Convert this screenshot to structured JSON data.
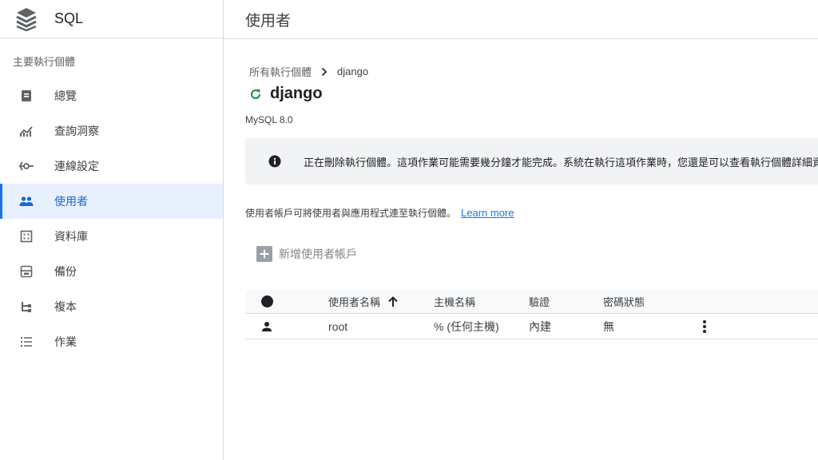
{
  "brand": {
    "title": "SQL",
    "logo_icon": "sql-stack-icon"
  },
  "sidebar": {
    "section_title": "主要執行個體",
    "items": [
      {
        "label": "總覽",
        "icon": "overview-icon",
        "active": false
      },
      {
        "label": "查詢洞察",
        "icon": "query-insights-icon",
        "active": false
      },
      {
        "label": "連線設定",
        "icon": "connections-icon",
        "active": false
      },
      {
        "label": "使用者",
        "icon": "users-icon",
        "active": true
      },
      {
        "label": "資料庫",
        "icon": "databases-icon",
        "active": false
      },
      {
        "label": "備份",
        "icon": "backups-icon",
        "active": false
      },
      {
        "label": "複本",
        "icon": "replicas-icon",
        "active": false
      },
      {
        "label": "作業",
        "icon": "operations-icon",
        "active": false
      }
    ]
  },
  "header": {
    "title": "使用者"
  },
  "breadcrumb": {
    "parent": "所有執行個體",
    "current": "django"
  },
  "instance": {
    "name": "django",
    "version": "MySQL 8.0",
    "status_icon": "refresh-status-icon"
  },
  "banner": {
    "text": "正在刪除執行個體。這項作業可能需要幾分鐘才能完成。系統在執行這項作業時，您還是可以查看執行個體詳細資料。"
  },
  "description": {
    "text": "使用者帳戶可將使用者與應用程式連至執行個體。",
    "learn_more": "Learn more"
  },
  "add_button": {
    "label": "新增使用者帳戶"
  },
  "table": {
    "columns": {
      "user_name": "使用者名稱",
      "host_name": "主機名稱",
      "auth": "驗證",
      "password_status": "密碼狀態"
    },
    "rows": [
      {
        "user_name": "root",
        "host_name": "% (任何主機)",
        "auth": "內建",
        "password_status": "無"
      }
    ]
  },
  "colors": {
    "accent": "#1a73e8",
    "active_bg": "#e8f0fe",
    "status_green": "#1e8e3e"
  }
}
